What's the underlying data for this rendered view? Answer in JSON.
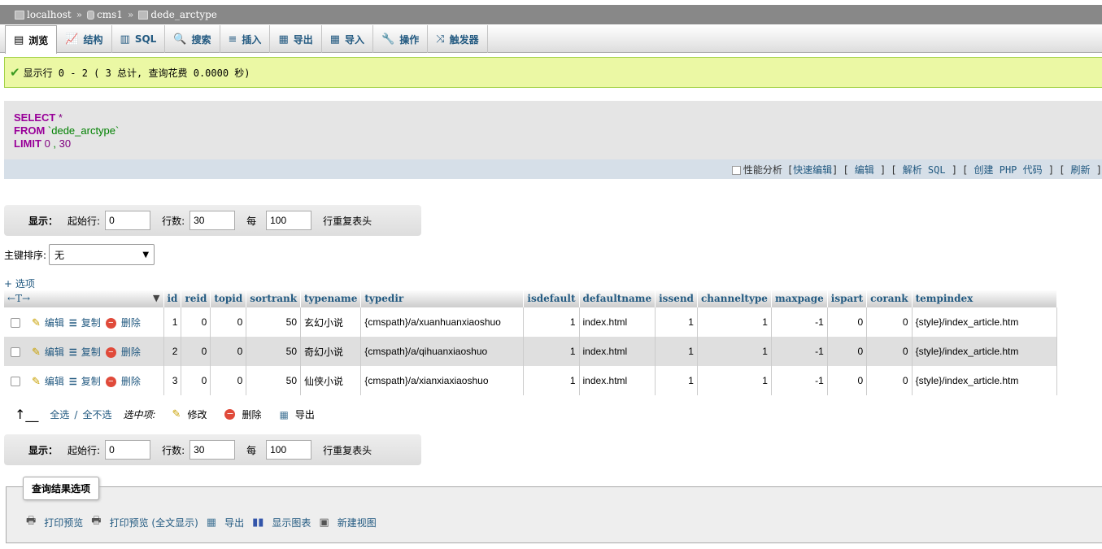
{
  "breadcrumb": {
    "server": "localhost",
    "database": "cms1",
    "table": "dede_arctype",
    "separator": "»"
  },
  "tabs": [
    {
      "label": "浏览",
      "icon": "table-icon"
    },
    {
      "label": "结构",
      "icon": "structure-icon"
    },
    {
      "label": "SQL",
      "icon": "sql-icon"
    },
    {
      "label": "搜索",
      "icon": "search-icon"
    },
    {
      "label": "插入",
      "icon": "insert-icon"
    },
    {
      "label": "导出",
      "icon": "export-icon"
    },
    {
      "label": "导入",
      "icon": "import-icon"
    },
    {
      "label": "操作",
      "icon": "wrench-icon"
    },
    {
      "label": "触发器",
      "icon": "triggers-icon"
    }
  ],
  "message": "显示行 0 - 2 ( 3 总计, 查询花费 0.0000 秒)",
  "sql": {
    "select_kw": "SELECT",
    "select_rest": "*",
    "from_kw": "FROM",
    "from_table": "`dede_arctype`",
    "limit_kw": "LIMIT",
    "limit_start": "0",
    "limit_comma": ",",
    "limit_count": "30"
  },
  "sql_toolbar": {
    "profiling": "性能分析",
    "inline_edit": "快速编辑",
    "edit": "编辑",
    "explain": "解析 SQL",
    "create_php": "创建 PHP 代码",
    "refresh": "刷新"
  },
  "nav": {
    "show_label": "显示：",
    "start_label": "起始行:",
    "start_value": "0",
    "rows_label": "行数:",
    "rows_value": "30",
    "every_label": "每",
    "repeat_value": "100",
    "repeat_label": "行重复表头"
  },
  "sort": {
    "label": "主键排序:",
    "value": "无"
  },
  "options_label": "+ 选项",
  "table": {
    "columns": [
      "id",
      "reid",
      "topid",
      "sortrank",
      "typename",
      "typedir",
      "isdefault",
      "defaultname",
      "issend",
      "channeltype",
      "maxpage",
      "ispart",
      "corank",
      "tempindex"
    ],
    "row_actions": {
      "edit": "编辑",
      "copy": "复制",
      "delete": "删除"
    },
    "rows": [
      [
        "1",
        "0",
        "0",
        "50",
        "玄幻小说",
        "{cmspath}/a/xuanhuanxiaoshuo",
        "1",
        "index.html",
        "1",
        "1",
        "-1",
        "0",
        "0",
        "{style}/index_article.htm"
      ],
      [
        "2",
        "0",
        "0",
        "50",
        "奇幻小说",
        "{cmspath}/a/qihuanxiaoshuo",
        "1",
        "index.html",
        "1",
        "1",
        "-1",
        "0",
        "0",
        "{style}/index_article.htm"
      ],
      [
        "3",
        "0",
        "0",
        "50",
        "仙侠小说",
        "{cmspath}/a/xianxiaxiaoshuo",
        "1",
        "index.html",
        "1",
        "1",
        "-1",
        "0",
        "0",
        "{style}/index_article.htm"
      ]
    ]
  },
  "bulk": {
    "select_all": "全选",
    "slash": "/",
    "unselect_all": "全不选",
    "with_selected": "选中项:",
    "change": "修改",
    "delete": "删除",
    "export": "导出"
  },
  "query_ops": {
    "legend": "查询结果选项",
    "print": "打印预览",
    "print_full": "打印预览 (全文显示)",
    "export": "导出",
    "chart": "显示图表",
    "create_view": "新建视图"
  },
  "colors": {
    "link": "#235a81",
    "success_bg": "#ebf8a4",
    "sql_keyword": "#990099",
    "header_bar": "#888888"
  }
}
